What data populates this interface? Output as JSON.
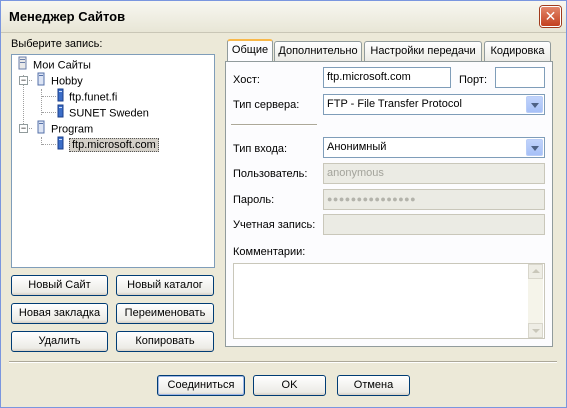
{
  "window": {
    "title": "Менеджер Сайтов",
    "close_glyph": "✕"
  },
  "left": {
    "select_label": "Выберите запись:",
    "tree": {
      "root": "Мои Сайты",
      "group1": "Hobby",
      "group1_items": [
        "ftp.funet.fi",
        "SUNET Sweden"
      ],
      "group2": "Program",
      "group2_items": [
        "ftp.microsoft.com"
      ]
    },
    "buttons": {
      "new_site": "Новый Сайт",
      "new_folder": "Новый каталог",
      "new_bookmark": "Новая закладка",
      "rename": "Переименовать",
      "delete": "Удалить",
      "copy": "Копировать"
    }
  },
  "tabs": [
    "Общие",
    "Дополнительно",
    "Настройки передачи",
    "Кодировка"
  ],
  "general": {
    "host_label": "Хост:",
    "host_value": "ftp.microsoft.com",
    "port_label": "Порт:",
    "port_value": "",
    "server_type_label": "Тип сервера:",
    "server_type_value": "FTP - File Transfer Protocol",
    "logon_type_label": "Тип входа:",
    "logon_type_value": "Анонимный",
    "user_label": "Пользователь:",
    "user_value": "anonymous",
    "password_label": "Пароль:",
    "password_value": "●●●●●●●●●●●●●●●",
    "account_label": "Учетная запись:",
    "account_value": "",
    "comments_label": "Комментарии:"
  },
  "footer": {
    "connect": "Соединиться",
    "ok": "OK",
    "cancel": "Отмена"
  },
  "colors": {
    "accent_border": "#003c74",
    "tab_highlight": "#f9b849",
    "selection": "#d4d0c8"
  }
}
